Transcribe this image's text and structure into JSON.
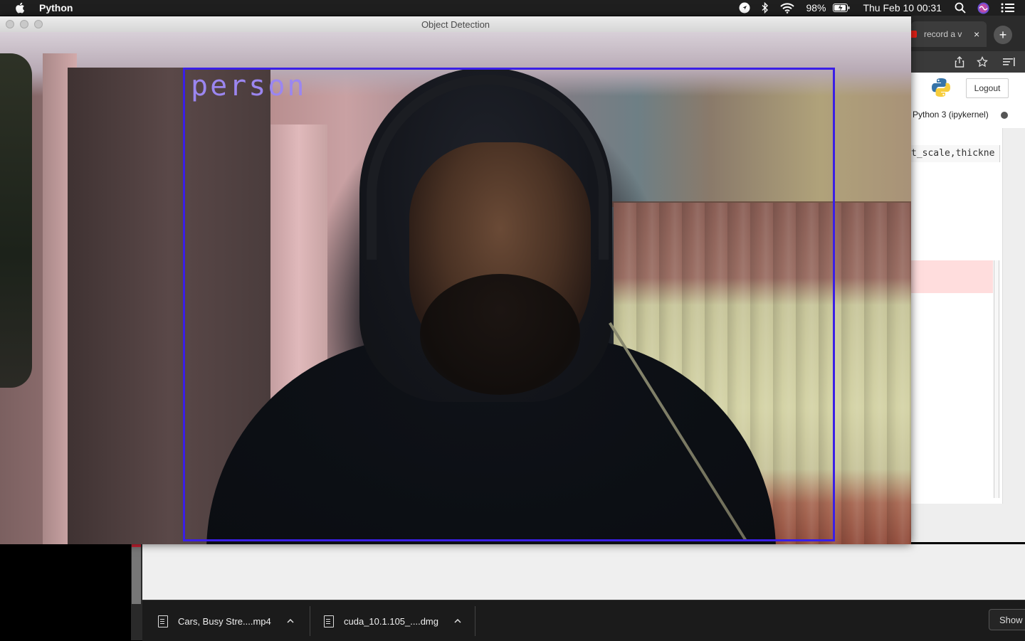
{
  "menubar": {
    "app_name": "Python",
    "battery": "98%",
    "datetime": "Thu Feb 10  00:31",
    "icons": [
      "apple-icon",
      "location-icon",
      "bluetooth-icon",
      "wifi-icon",
      "battery-icon",
      "search-icon",
      "siri-icon",
      "control-center-icon"
    ]
  },
  "window": {
    "title": "Object Detection",
    "detection_label": "person",
    "detection_box_color": "#3a1fe6",
    "label_color": "#9b86f0"
  },
  "browser": {
    "tab_title": "record a v",
    "tab_close": "×",
    "new_tab": "+",
    "logout_label": "Logout",
    "kernel_name": "Python 3 (ipykernel)",
    "code_snippet": "t_scale,thickne"
  },
  "downloads": {
    "items": [
      {
        "name": "Cars, Busy Stre....mp4"
      },
      {
        "name": "cuda_10.1.105_....dmg"
      }
    ],
    "show_all_label": "Show"
  }
}
